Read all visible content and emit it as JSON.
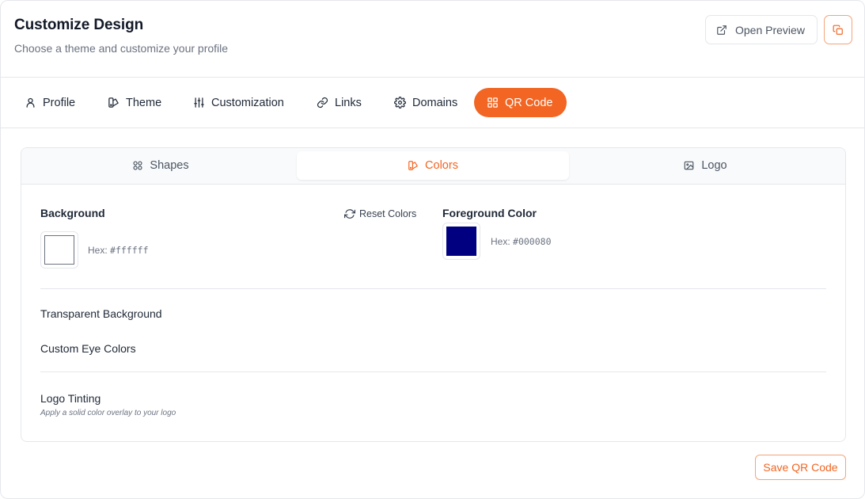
{
  "header": {
    "title": "Customize Design",
    "subtitle": "Choose a theme and customize your profile",
    "open_preview_label": "Open Preview"
  },
  "tabs": [
    {
      "label": "Profile",
      "icon": "user-icon"
    },
    {
      "label": "Theme",
      "icon": "palette-icon"
    },
    {
      "label": "Customization",
      "icon": "sliders-icon"
    },
    {
      "label": "Links",
      "icon": "link-icon"
    },
    {
      "label": "Domains",
      "icon": "gear-icon"
    },
    {
      "label": "QR Code",
      "icon": "qr-grid-icon",
      "active": true
    }
  ],
  "subtabs": [
    {
      "label": "Shapes",
      "icon": "shapes-icon"
    },
    {
      "label": "Colors",
      "icon": "palette-icon",
      "active": true
    },
    {
      "label": "Logo",
      "icon": "image-icon"
    }
  ],
  "colors": {
    "background": {
      "label": "Background",
      "hex_prefix": "Hex:",
      "hex_value": "#ffffff",
      "swatch": "#ffffff"
    },
    "reset_label": "Reset Colors",
    "foreground": {
      "label": "Foreground Color",
      "hex_prefix": "Hex:",
      "hex_value": "#000080",
      "swatch": "#000080"
    },
    "transparent_label": "Transparent Background",
    "eye_colors_label": "Custom Eye Colors",
    "logo_tinting_label": "Logo Tinting",
    "logo_tinting_hint": "Apply a solid color overlay to your logo"
  },
  "save_label": "Save QR Code",
  "theme": {
    "accent": "#f26522",
    "border": "#e5e7eb",
    "text_muted": "#6b7280"
  }
}
